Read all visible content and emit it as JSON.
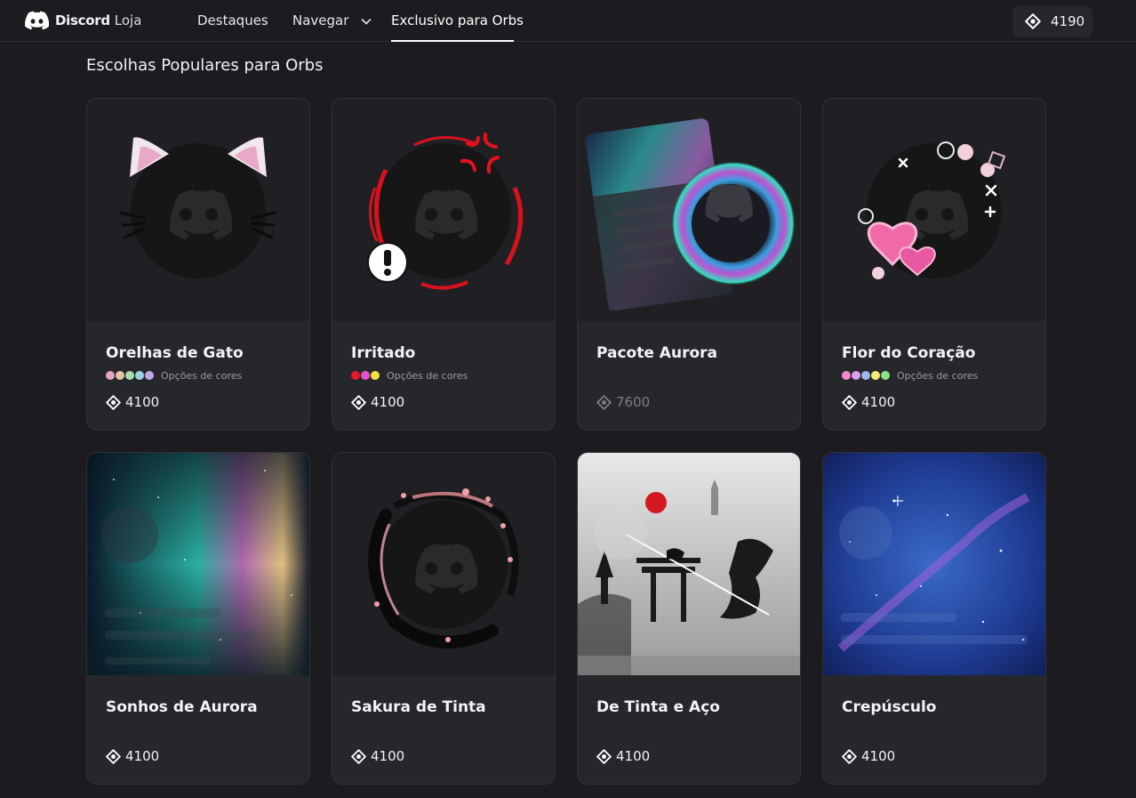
{
  "header": {
    "brand": "Discord",
    "brand_sub": "Loja",
    "nav": [
      "Destaques",
      "Navegar",
      "Exclusivo para Orbs"
    ],
    "balance": "4190"
  },
  "section": {
    "title": "Escolhas Populares para Orbs"
  },
  "cards": [
    {
      "name": "Orelhas de Gato",
      "colors_label": "Opções de cores",
      "swatches": [
        "#e3a3c4",
        "#e3c6a5",
        "#a8dcb5",
        "#9ad4e6",
        "#c3a8e6"
      ],
      "price": "4100"
    },
    {
      "name": "Irritado",
      "colors_label": "Opções de cores",
      "swatches": [
        "#e8182e",
        "#e84fd0",
        "#f2e23a"
      ],
      "price": "4100"
    },
    {
      "name": "Pacote Aurora",
      "price": "7600"
    },
    {
      "name": "Flor do Coração",
      "colors_label": "Opções de cores",
      "swatches": [
        "#f08ac8",
        "#d9a0f0",
        "#9ab8f0",
        "#f2ea72",
        "#8de08a"
      ],
      "price": "4100"
    },
    {
      "name": "Sonhos de Aurora",
      "price": "4100"
    },
    {
      "name": "Sakura de Tinta",
      "price": "4100"
    },
    {
      "name": "De Tinta e Aço",
      "price": "4100"
    },
    {
      "name": "Crepúsculo",
      "price": "4100"
    }
  ]
}
